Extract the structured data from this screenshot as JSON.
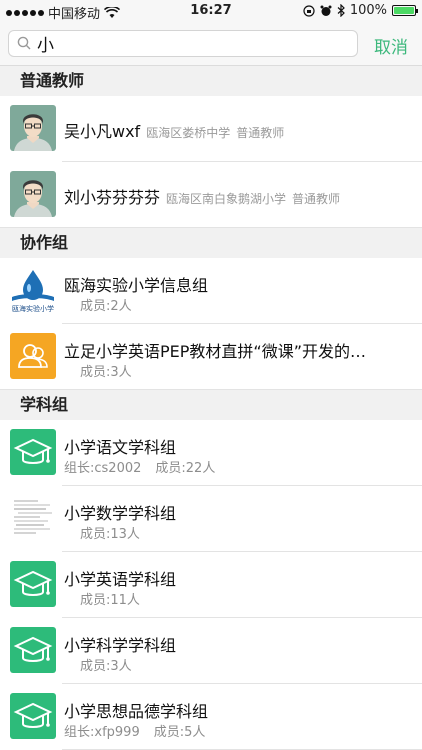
{
  "status_bar": {
    "carrier": "中国移动",
    "time": "16:27",
    "battery": "100%",
    "battery_level": 1.0
  },
  "search": {
    "value": "小",
    "cancel_label": "取消"
  },
  "sections": {
    "teachers": {
      "header": "普通教师",
      "items": [
        {
          "name": "吴小凡wxf",
          "school": "瓯海区娄桥中学",
          "role": "普通教师"
        },
        {
          "name": "刘小芬芬芬芬",
          "school": "瓯海区南白象鹅湖小学",
          "role": "普通教师"
        }
      ]
    },
    "groups": {
      "header": "协作组",
      "items": [
        {
          "title": "瓯海实验小学信息组",
          "members": "成员:2人",
          "logo_text": "瓯海实验小学"
        },
        {
          "title": "立足小学英语PEP教材直拼“微课”开发的…",
          "members": "成员:3人"
        }
      ]
    },
    "subjects": {
      "header": "学科组",
      "items": [
        {
          "title": "小学语文学科组",
          "leader": "组长:cs2002",
          "members": "成员:22人"
        },
        {
          "title": "小学数学学科组",
          "members": "成员:13人"
        },
        {
          "title": "小学英语学科组",
          "members": "成员:11人"
        },
        {
          "title": "小学科学学科组",
          "members": "成员:3人"
        },
        {
          "title": "小学思想品德学科组",
          "leader": "组长:xfp999",
          "members": "成员:5人"
        }
      ]
    }
  },
  "colors": {
    "accent": "#3cb87c",
    "subject_icon": "#2dbb7a",
    "group_icon": "#f5a623"
  }
}
